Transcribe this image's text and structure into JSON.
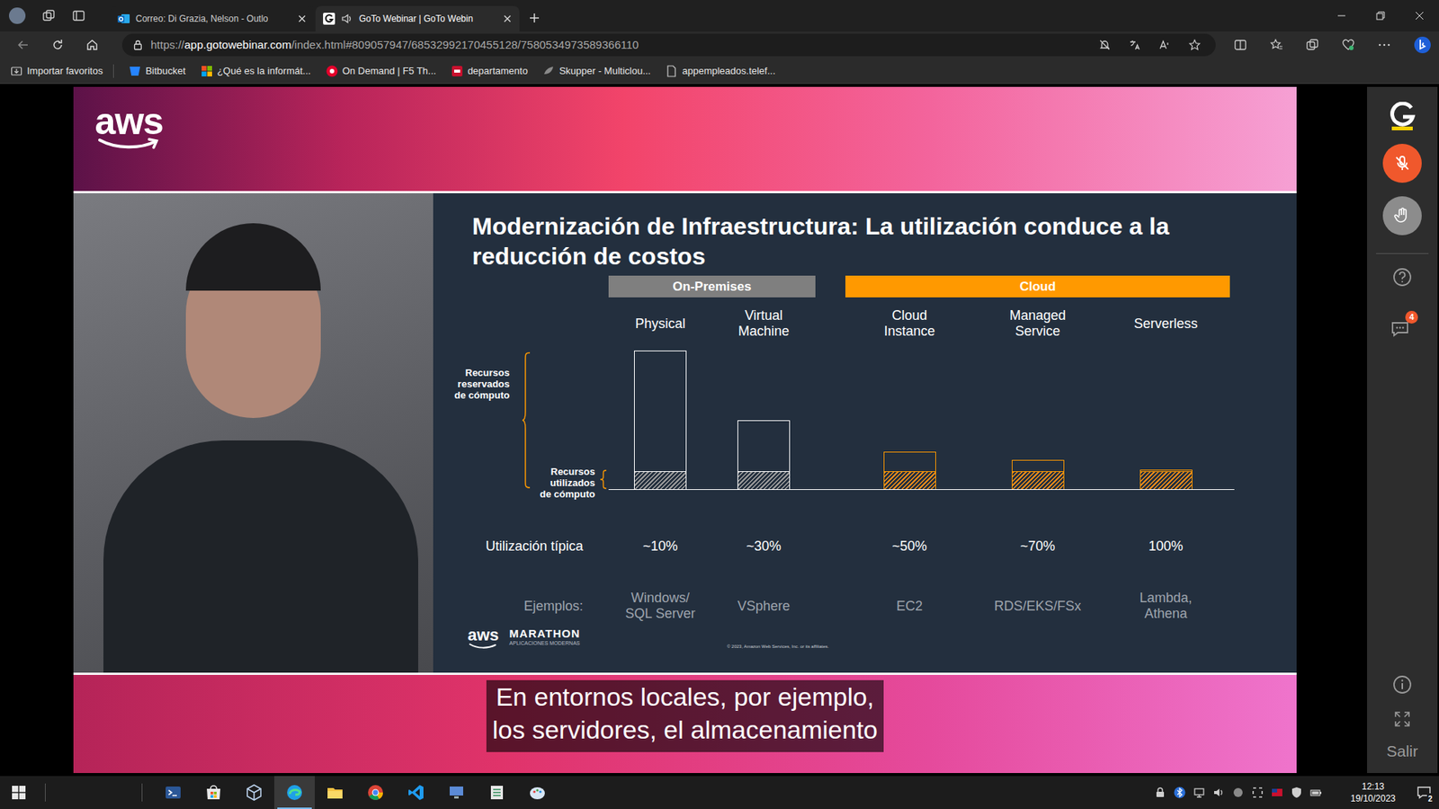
{
  "browser": {
    "tabs": [
      {
        "label": "Correo: Di Grazia, Nelson - Outlo",
        "selected": false,
        "kind": "mail"
      },
      {
        "label": "GoTo Webinar | GoTo Webin",
        "selected": true,
        "kind": "webinar"
      }
    ],
    "url": {
      "scheme": "https://",
      "host": "app.gotowebinar.com",
      "path": "/index.html#809057947/68532992170455128/7580534973589366110"
    },
    "bookmarks": [
      {
        "label": "Importar favoritos",
        "kind": "import"
      },
      {
        "label": "Bitbucket",
        "kind": "bitbucket"
      },
      {
        "label": "¿Qué es la informát...",
        "kind": "windows"
      },
      {
        "label": "On Demand | F5 Th...",
        "kind": "f5"
      },
      {
        "label": "departamento",
        "kind": "pdf"
      },
      {
        "label": "Skupper - Multiclou...",
        "kind": "skupper"
      },
      {
        "label": "appempleados.telef...",
        "kind": "page"
      }
    ]
  },
  "webinar": {
    "banner_logo": "aws",
    "slide": {
      "title": "Modernización de Infraestructura: La utilización conduce a la reducción de costos",
      "brace_labels": {
        "reserved": "Recursos\nreservados\nde cómputo",
        "used": "Recursos\nutilizados\nde cómputo"
      },
      "row_labels": {
        "utilization": "Utilización típica",
        "examples": "Ejemplos:"
      },
      "groups": [
        {
          "label": "On-Premises",
          "color": "#7f7f7f",
          "outline": "#ffffff",
          "hatch": "#9a9a9a",
          "columns": [
            {
              "name": "Physical",
              "utilization": "~10%",
              "examples": "Windows/\nSQL Server",
              "reserved": 100,
              "used": 14
            },
            {
              "name": "Virtual\nMachine",
              "utilization": "~30%",
              "examples": "VSphere",
              "reserved": 50,
              "used": 14
            }
          ]
        },
        {
          "label": "Cloud",
          "color": "#ff9900",
          "outline": "#ff9900",
          "hatch": "#e8891a",
          "columns": [
            {
              "name": "Cloud\nInstance",
              "utilization": "~50%",
              "examples": "EC2",
              "reserved": 27,
              "used": 14
            },
            {
              "name": "Managed\nService",
              "utilization": "~70%",
              "examples": "RDS/EKS/FSx",
              "reserved": 21,
              "used": 14
            },
            {
              "name": "Serverless",
              "utilization": "100%",
              "examples": "Lambda,\nAthena",
              "reserved": 14,
              "used": 14
            }
          ]
        }
      ],
      "footer": {
        "logo": "aws",
        "brand": "MARATHON",
        "tagline": "APLICACIONES MODERNAS",
        "copyright": "© 2023, Amazon Web Services, Inc. or its affiliates."
      }
    },
    "subtitle": "En entornos locales, por ejemplo,\nlos servidores, el almacenamiento"
  },
  "sidebar": {
    "chat_badge": "4",
    "exit": "Salir"
  },
  "taskbar": {
    "apps": [
      {
        "kind": "terminal",
        "selected": false
      },
      {
        "kind": "store",
        "selected": false
      },
      {
        "kind": "virtualbox",
        "selected": false
      },
      {
        "kind": "edge",
        "selected": true
      },
      {
        "kind": "explorer",
        "selected": false
      },
      {
        "kind": "chrome",
        "selected": false
      },
      {
        "kind": "vscode",
        "selected": false
      },
      {
        "kind": "remote",
        "selected": false
      },
      {
        "kind": "sheet",
        "selected": false
      },
      {
        "kind": "paint",
        "selected": false
      }
    ],
    "time": "12:13",
    "date": "19/10/2023",
    "notifications": "2"
  }
}
